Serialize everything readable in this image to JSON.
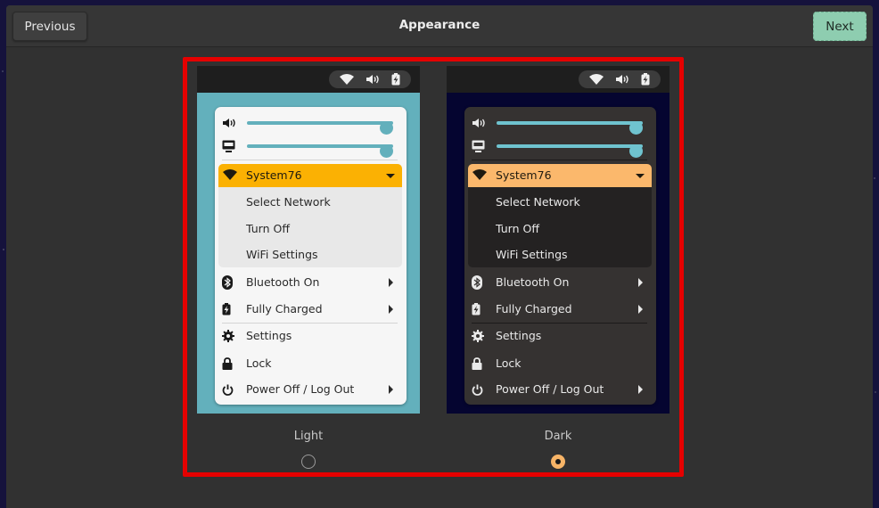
{
  "header": {
    "title": "Appearance",
    "previous_label": "Previous",
    "next_label": "Next"
  },
  "colors": {
    "next_button": "#8ecdb0",
    "highlight_border": "#e50000",
    "light_wallpaper": "#63b0bc",
    "dark_wallpaper": "#050530",
    "light_accent": "#fbb103",
    "dark_accent": "#fbb86c",
    "slider": "#63b0bc"
  },
  "tray_icons": [
    "wifi-icon",
    "volume-icon",
    "battery-charging-icon"
  ],
  "previews": [
    {
      "id": "light",
      "label": "Light",
      "selected": false,
      "sliders": [
        {
          "icon": "volume-icon",
          "value_percent": 100
        },
        {
          "icon": "display-brightness-icon",
          "value_percent": 100
        }
      ],
      "wifi": {
        "network": "System76",
        "sub_items": [
          "Select Network",
          "Turn Off",
          "WiFi Settings"
        ]
      },
      "items": [
        {
          "icon": "bluetooth-icon",
          "label": "Bluetooth On",
          "submenu": true
        },
        {
          "icon": "battery-charging-icon",
          "label": "Fully Charged",
          "submenu": true
        },
        {
          "icon": "gear-icon",
          "label": "Settings",
          "submenu": false
        },
        {
          "icon": "lock-icon",
          "label": "Lock",
          "submenu": false
        },
        {
          "icon": "power-icon",
          "label": "Power Off / Log Out",
          "submenu": true
        }
      ]
    },
    {
      "id": "dark",
      "label": "Dark",
      "selected": true,
      "sliders": [
        {
          "icon": "volume-icon",
          "value_percent": 100
        },
        {
          "icon": "display-brightness-icon",
          "value_percent": 100
        }
      ],
      "wifi": {
        "network": "System76",
        "sub_items": [
          "Select Network",
          "Turn Off",
          "WiFi Settings"
        ]
      },
      "items": [
        {
          "icon": "bluetooth-icon",
          "label": "Bluetooth On",
          "submenu": true
        },
        {
          "icon": "battery-charging-icon",
          "label": "Fully Charged",
          "submenu": true
        },
        {
          "icon": "gear-icon",
          "label": "Settings",
          "submenu": false
        },
        {
          "icon": "lock-icon",
          "label": "Lock",
          "submenu": false
        },
        {
          "icon": "power-icon",
          "label": "Power Off / Log Out",
          "submenu": true
        }
      ]
    }
  ]
}
